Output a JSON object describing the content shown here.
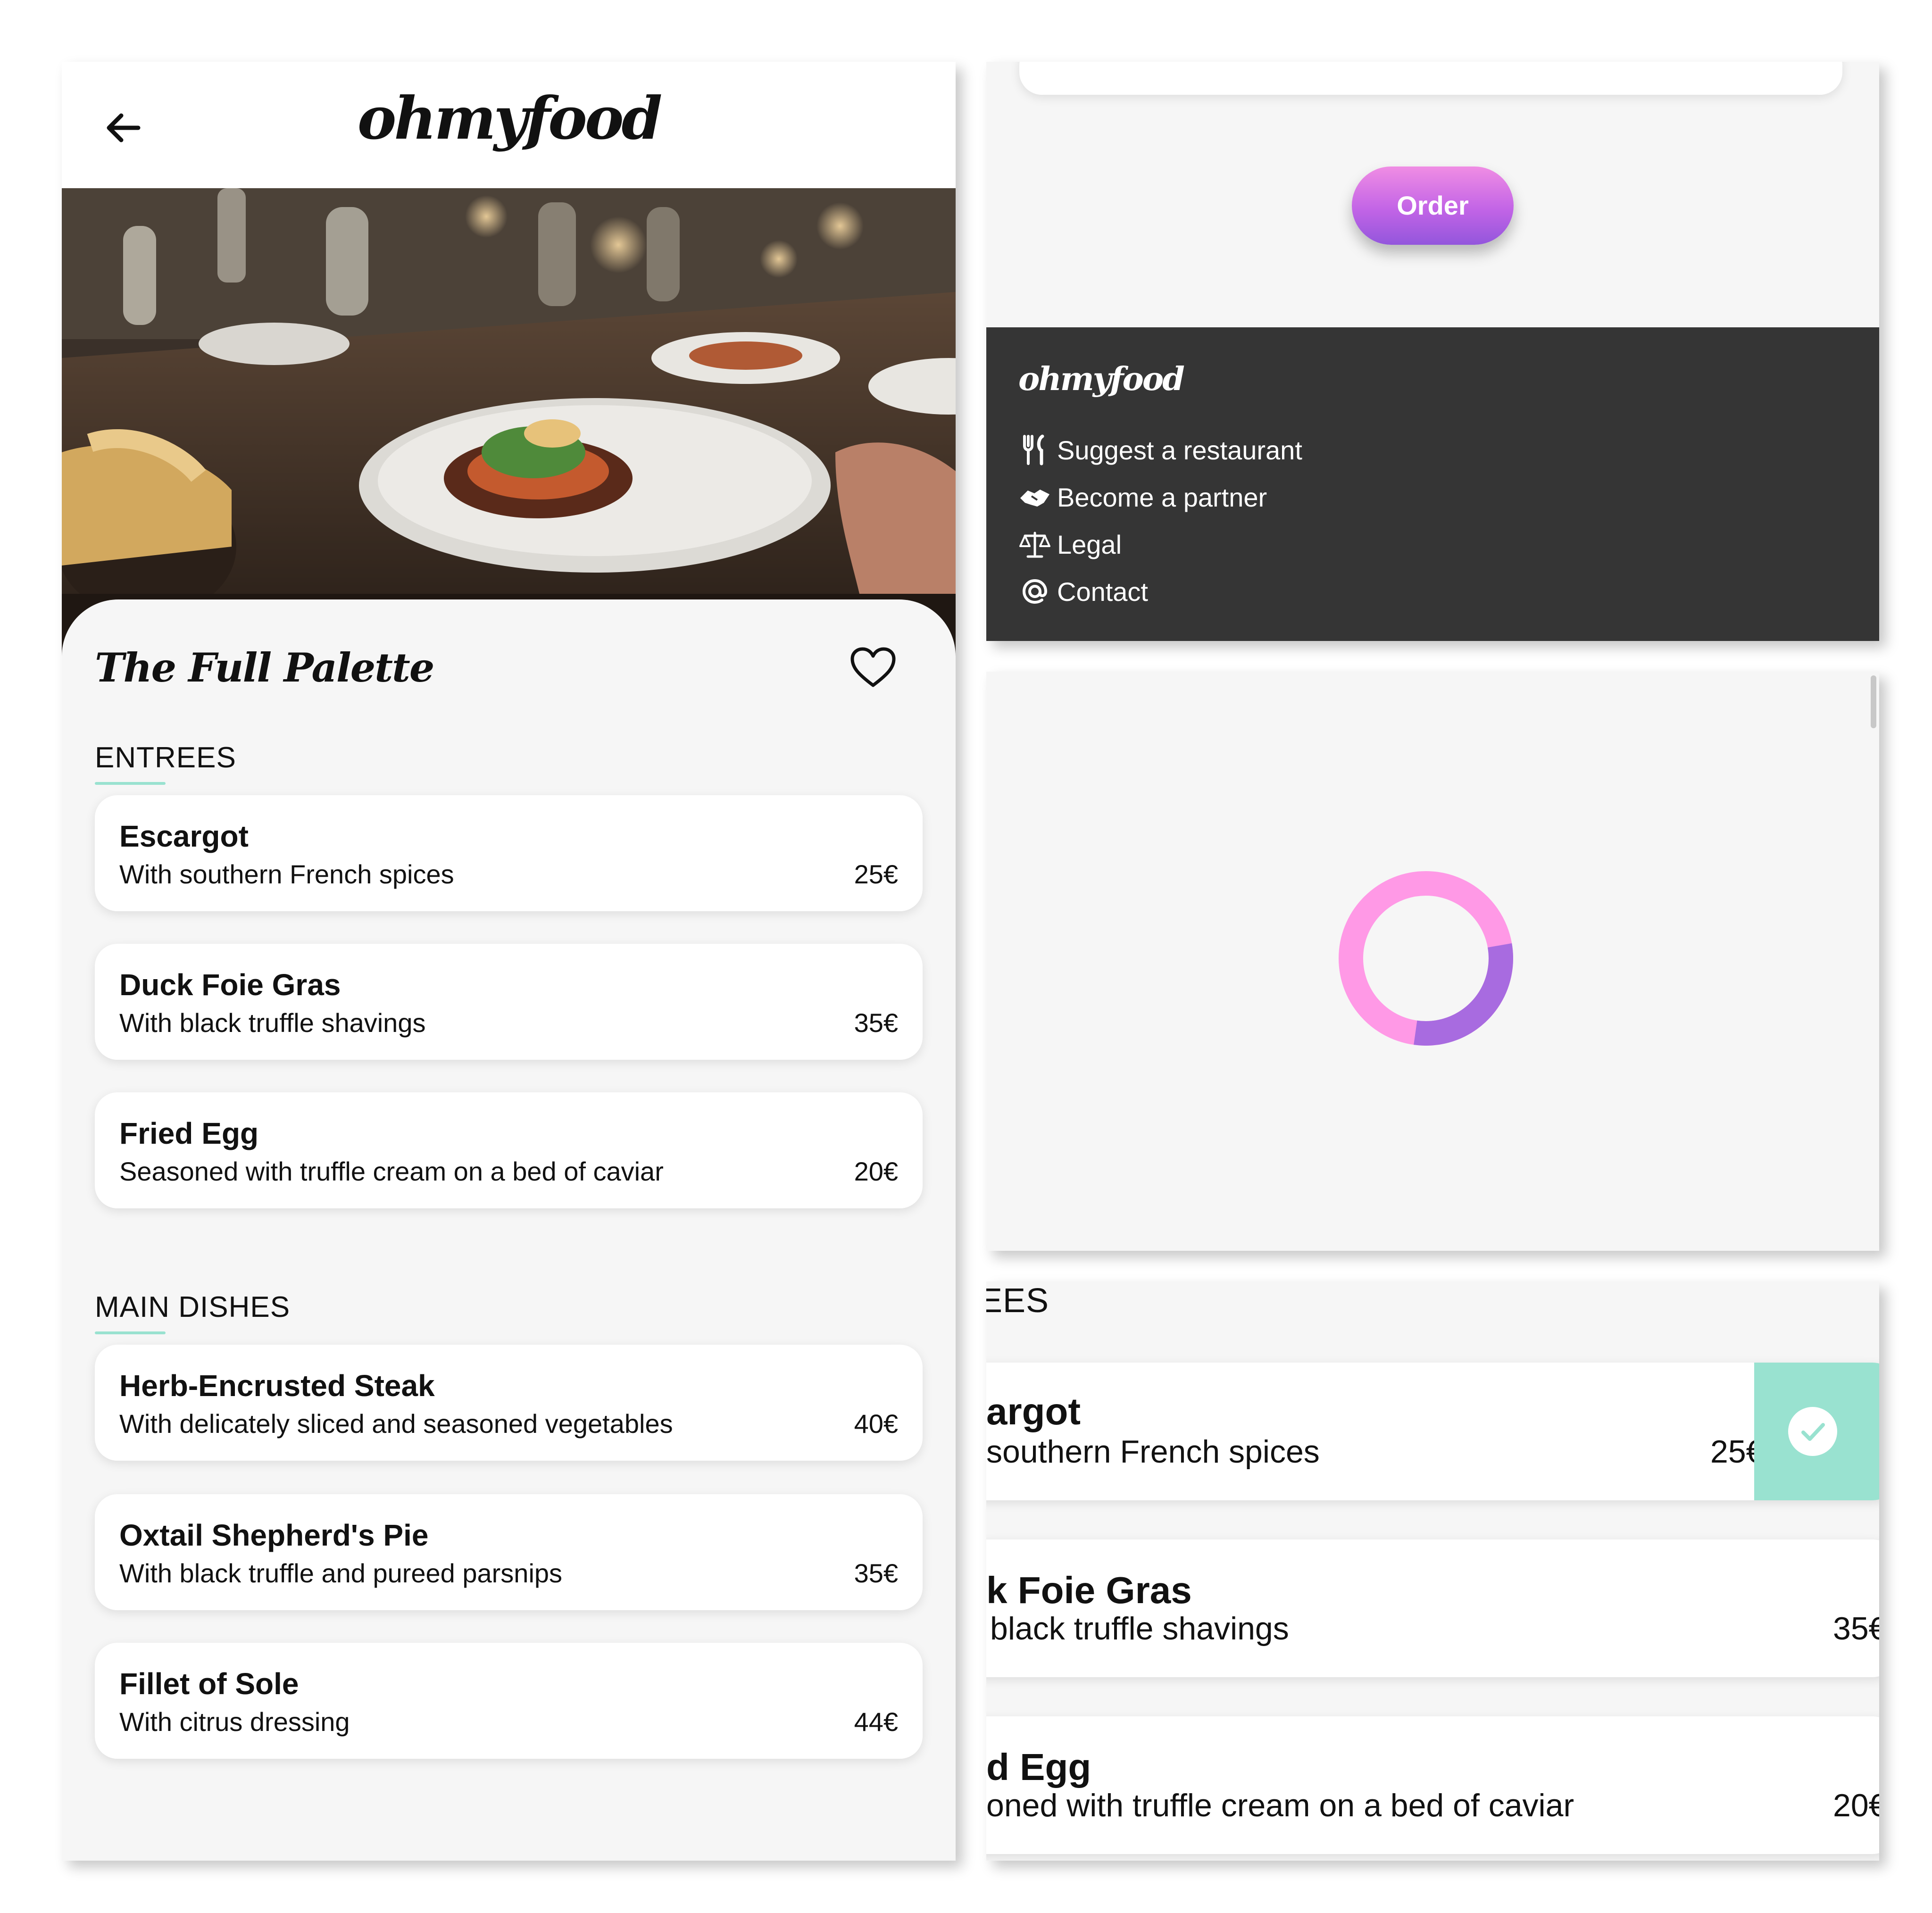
{
  "app": {
    "logo": "ohmyfood"
  },
  "restaurant": {
    "name": "The Full Palette"
  },
  "menu": {
    "sections": [
      {
        "label": "ENTREES",
        "dishes": [
          {
            "name": "Escargot",
            "desc": "With southern French spices",
            "price": "25€"
          },
          {
            "name": "Duck Foie Gras",
            "desc": "With black truffle shavings",
            "price": "35€"
          },
          {
            "name": "Fried Egg",
            "desc": "Seasoned with truffle cream on a bed of caviar",
            "price": "20€"
          }
        ]
      },
      {
        "label": "MAIN DISHES",
        "dishes": [
          {
            "name": "Herb-Encrusted Steak",
            "desc": "With delicately sliced and seasoned vegetables",
            "price": "40€"
          },
          {
            "name": "Oxtail Shepherd's Pie",
            "desc": "With black truffle and pureed parsnips",
            "price": "35€"
          },
          {
            "name": "Fillet of Sole",
            "desc": "With citrus dressing",
            "price": "44€"
          }
        ]
      }
    ]
  },
  "order": {
    "button_label": "Order"
  },
  "footer": {
    "logo": "ohmyfood",
    "links": [
      {
        "label": "Suggest a restaurant",
        "icon": "utensils-icon"
      },
      {
        "label": "Become a partner",
        "icon": "handshake-icon"
      },
      {
        "label": "Legal",
        "icon": "scale-icon"
      },
      {
        "label": "Contact",
        "icon": "at-icon"
      }
    ]
  },
  "loader": {
    "progress": 0.3
  },
  "swipe_view": {
    "heading_fragment": "EES",
    "rows": [
      {
        "name": "argot",
        "desc": " southern French spices",
        "price": "25€",
        "checked": true
      },
      {
        "name": "k Foie Gras",
        "desc": "black truffle shavings",
        "price": "35€",
        "checked": false
      },
      {
        "name": "d Egg",
        "desc": "oned with truffle cream on a bed of caviar",
        "price": "20€",
        "checked": false
      }
    ]
  },
  "colors": {
    "accent_mint": "#99E2D0",
    "order_gradient_top": "#F08DE4",
    "order_gradient_bottom": "#9356DC",
    "loader_pink": "#FF99E6",
    "loader_purple": "#A86BE0",
    "footer_bg": "#353535",
    "page_bg": "#F6F6F6"
  }
}
